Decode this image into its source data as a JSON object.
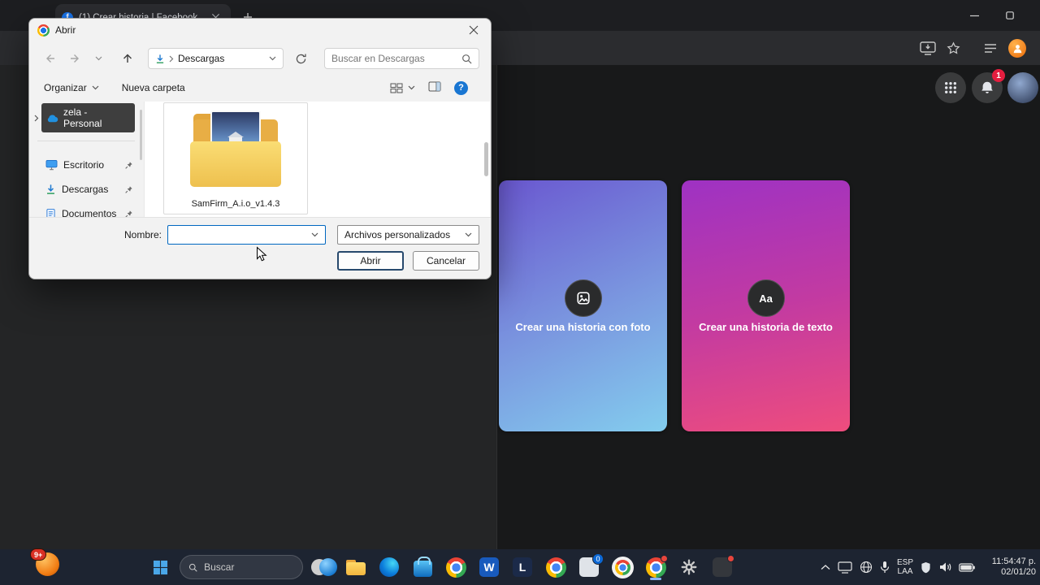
{
  "window": {
    "tab_title": "(1) Crear historia | Facebook"
  },
  "icons": {
    "favicon": "f",
    "help": "?",
    "word": "W",
    "l_app": "L"
  },
  "dialog": {
    "title": "Abrir",
    "breadcrumb": "Descargas",
    "search_placeholder": "Buscar en Descargas",
    "organize_label": "Organizar",
    "new_folder_label": "Nueva carpeta",
    "sidebar": {
      "items": [
        {
          "label": "zela - Personal"
        },
        {
          "label": "Escritorio"
        },
        {
          "label": "Descargas"
        },
        {
          "label": "Documentos"
        }
      ]
    },
    "files": [
      {
        "name": "SamFirm_A.i.o_v1.4.3"
      }
    ],
    "name_label": "Nombre:",
    "name_value": "",
    "filetype_value": "Archivos personalizados",
    "open_label": "Abrir",
    "cancel_label": "Cancelar"
  },
  "facebook": {
    "notification_count": "1",
    "cards": [
      {
        "label": "Crear una historia con foto"
      },
      {
        "label": "Crear una historia de texto",
        "icon_text": "Aa"
      }
    ]
  },
  "taskbar": {
    "search_placeholder": "Buscar",
    "corner_badge": "9+",
    "app_badge_zero": "0",
    "tray": {
      "lang_top": "ESP",
      "lang_bottom": "LAA",
      "time": "11:54:47 p.",
      "date": "02/01/20"
    }
  },
  "colors": {
    "accent_focus": "#0067c0",
    "badge_red": "#e41e3f",
    "card_photo_top": "#6a58d0",
    "card_photo_bottom": "#83cdee",
    "card_text_top": "#9e32c3",
    "card_text_bottom": "#ee4d7d",
    "taskbar_bg": "#1d2431"
  }
}
